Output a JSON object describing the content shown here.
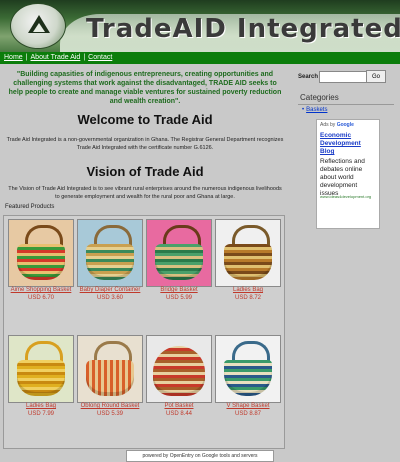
{
  "header": {
    "title": "TradeAID Integrated",
    "logo": "trade-aid-logo"
  },
  "nav": {
    "items": [
      "Home",
      "About Trade Aid",
      "Contact"
    ],
    "separator": "|"
  },
  "main": {
    "tagline": "\"Building capasities of indigenous entrepreneurs, creating opportunities and challenging systems that work against the disadvantaged, TRADE AID seeks to help people to create and manage viable ventures for sustained poverty reduction and wealth creation\".",
    "welcome_heading": "Welcome to Trade Aid",
    "intro": "Trade Aid Integrated is a non-governmental organization in Ghana. The Registrar General Department recognizes Trade Aid Integrated with the certificate number G.6126.",
    "vision_heading": "Vision of Trade Aid",
    "vision": "The Vision of Trade Aid Integrated is to see vibrant rural enterprises around the numerous indigenous livelihoods to generate employment and wealth for the rural poor and Ghana at large.",
    "featured_label": "Featured Products",
    "products": [
      {
        "name": "Aime Shopping Basket",
        "price": "USD 6.70"
      },
      {
        "name": "Baby Diaper Container",
        "price": "USD 3.60"
      },
      {
        "name": "Bridge Basket",
        "price": "USD 5.99"
      },
      {
        "name": "Ladies Bag",
        "price": "USD 8.72"
      },
      {
        "name": "Ladies Bag",
        "price": "USD 7.99"
      },
      {
        "name": "Oblong Round Basket",
        "price": "USD 5.39"
      },
      {
        "name": "Pot Basket",
        "price": "USD 8.44"
      },
      {
        "name": "V Shape Basket",
        "price": "USD 8.87"
      }
    ],
    "powered_by": "powered by OpenEntry on Google tools and servers"
  },
  "sidebar": {
    "search_label": "Search",
    "search_value": "",
    "go_label": "Go",
    "categories_heading": "Categories",
    "categories": [
      "Baskets"
    ],
    "ad": {
      "label_prefix": "Ads by",
      "label_brand": "Google",
      "title": "Economic Development Blog",
      "text": "Reflections and debates online about world development issues",
      "url": "www.ideas4development.org"
    }
  }
}
